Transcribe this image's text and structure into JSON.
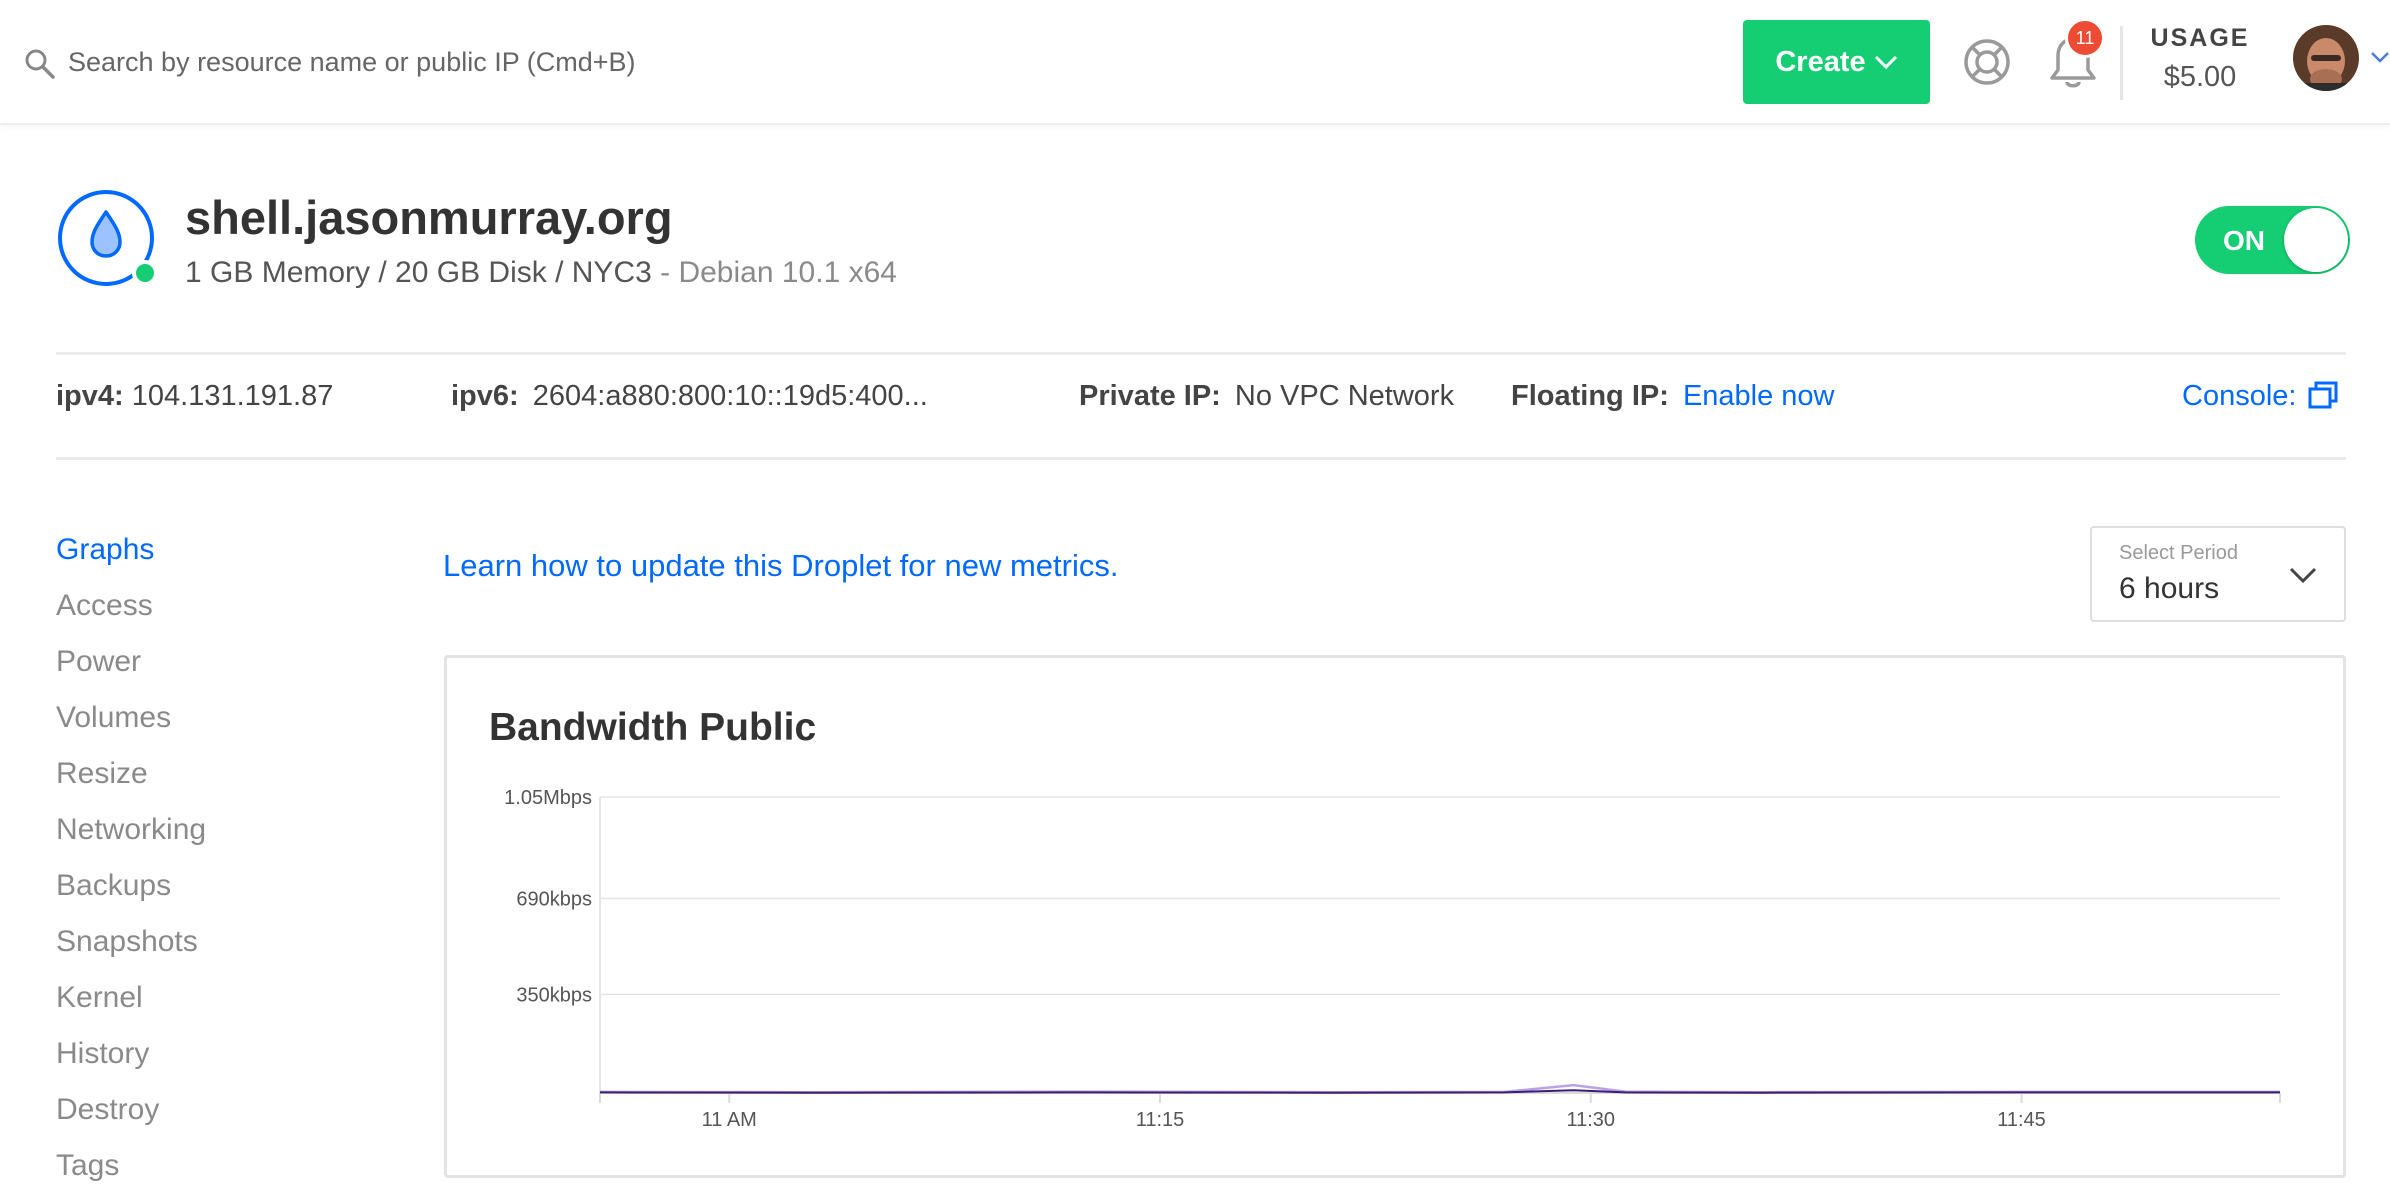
{
  "search": {
    "placeholder": "Search by resource name or public IP (Cmd+B)"
  },
  "header": {
    "create_label": "Create",
    "notification_count": "11",
    "usage_label": "USAGE",
    "usage_value": "$5.00"
  },
  "droplet": {
    "name": "shell.jasonmurray.org",
    "specs": "1 GB Memory / 20 GB Disk / NYC3",
    "os": " - Debian 10.1 x64",
    "power_label": "ON",
    "power_state": "on"
  },
  "network": {
    "ipv4_label": "ipv4:",
    "ipv4_value": "104.131.191.87",
    "ipv6_label": "ipv6:",
    "ipv6_value": "2604:a880:800:10::19d5:400...",
    "private_label": "Private IP:",
    "private_value": "No VPC Network",
    "floating_label": "Floating IP:",
    "floating_link": "Enable now",
    "console_label": "Console:"
  },
  "sidenav": {
    "items": [
      {
        "label": "Graphs",
        "active": true
      },
      {
        "label": "Access"
      },
      {
        "label": "Power"
      },
      {
        "label": "Volumes"
      },
      {
        "label": "Resize"
      },
      {
        "label": "Networking"
      },
      {
        "label": "Backups"
      },
      {
        "label": "Snapshots"
      },
      {
        "label": "Kernel"
      },
      {
        "label": "History"
      },
      {
        "label": "Destroy"
      },
      {
        "label": "Tags"
      }
    ]
  },
  "main": {
    "learn_link": "Learn how to update this Droplet for new metrics.",
    "period_label": "Select Period",
    "period_value": "6 hours"
  },
  "graph": {
    "title": "Bandwidth Public"
  },
  "chart_data": {
    "type": "line",
    "title": "Bandwidth Public",
    "xlabel": "",
    "ylabel": "",
    "y_unit": "kbps",
    "ylim": [
      0,
      1050
    ],
    "y_ticks": [
      {
        "value": 1050,
        "label": "1.05Mbps"
      },
      {
        "value": 690,
        "label": "690kbps"
      },
      {
        "value": 350,
        "label": "350kbps"
      }
    ],
    "x_range_minutes": [
      10.925,
      11.9
    ],
    "x_ticks": [
      {
        "value": 11.0,
        "label": "11 AM"
      },
      {
        "value": 11.25,
        "label": "11:15"
      },
      {
        "value": 11.5,
        "label": "11:30"
      },
      {
        "value": 11.75,
        "label": "11:45"
      }
    ],
    "grid": true,
    "series": [
      {
        "color": "#b9a3e6",
        "x": [
          10.925,
          11.05,
          11.2,
          11.35,
          11.45,
          11.49,
          11.52,
          11.6,
          11.75,
          11.9
        ],
        "y": [
          4,
          3,
          5,
          3,
          4,
          28,
          5,
          3,
          4,
          4
        ]
      },
      {
        "color": "#3c1e73",
        "x": [
          10.925,
          11.05,
          11.2,
          11.35,
          11.45,
          11.49,
          11.52,
          11.6,
          11.75,
          11.9
        ],
        "y": [
          2,
          1,
          2,
          1,
          2,
          10,
          2,
          1,
          2,
          2
        ]
      }
    ],
    "colors": {
      "accent": "#0069ff",
      "create": "#15cd72",
      "badge": "#ee4b35"
    }
  }
}
